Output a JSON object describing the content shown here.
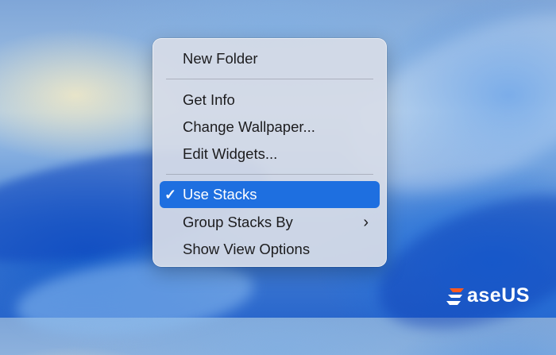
{
  "context_menu": {
    "items": [
      {
        "label": "New Folder"
      },
      {
        "label": "Get Info"
      },
      {
        "label": "Change Wallpaper..."
      },
      {
        "label": "Edit Widgets..."
      },
      {
        "label": "Use Stacks",
        "checked": true,
        "highlighted": true,
        "check_glyph": "✓"
      },
      {
        "label": "Group Stacks By",
        "submenu": true,
        "chevron_glyph": "›"
      },
      {
        "label": "Show View Options"
      }
    ]
  },
  "watermark": {
    "brand_text": "aseUS",
    "brand_full": "EaseUS",
    "icon": "easeus-logo-icon",
    "colors": {
      "accent": "#ff5a1f",
      "text": "#ffffff"
    }
  },
  "colors": {
    "menu_background": "#d6dbe7",
    "highlight": "#1e6fe0",
    "text": "#1c1c1e"
  }
}
